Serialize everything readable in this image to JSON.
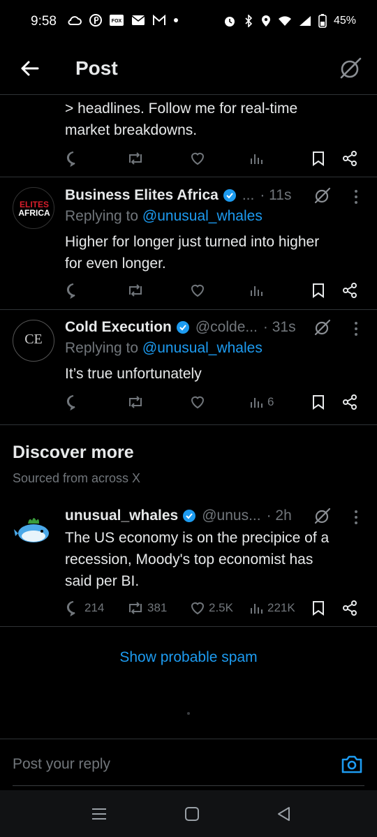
{
  "status_bar": {
    "time": "9:58",
    "battery": "45%",
    "left_icons": [
      "cloud-icon",
      "pinterest-icon",
      "fox-news-icon",
      "mail-icon",
      "gmail-icon",
      "dot-icon"
    ],
    "right_icons": [
      "alarm-icon",
      "bluetooth-icon",
      "location-icon",
      "wifi-icon",
      "signal-icon",
      "battery-icon"
    ]
  },
  "header": {
    "title": "Post"
  },
  "tweets": [
    {
      "text": "> headlines. Follow me for real-time market breakdowns.",
      "text_line1": "> headlines. Follow me for real-time",
      "text_line2": "market breakdowns."
    },
    {
      "name": "Business Elites Africa",
      "handle": "...",
      "time": "· 11s",
      "reply_prefix": "Replying to ",
      "reply_to": "@unusual_whales",
      "text_line1": "Higher for longer just turned into higher",
      "text_line2": "for even longer.",
      "avatar_text_1": "ELITES",
      "avatar_text_2": "AFRICA"
    },
    {
      "name": "Cold Execution",
      "handle": "@colde...",
      "time": "· 31s",
      "reply_prefix": "Replying to ",
      "reply_to": "@unusual_whales",
      "text_line1": "It’s true unfortunately",
      "views": "6",
      "avatar_text": "CE"
    }
  ],
  "discover": {
    "title": "Discover more",
    "subtitle": "Sourced from across X"
  },
  "discover_tweet": {
    "name": "unusual_whales",
    "handle": "@unus...",
    "time": "· 2h",
    "text_line1": "The US economy is on the precipice of a",
    "text_line2": "recession, Moody's top economist has",
    "text_line3": "said per BI.",
    "replies": "214",
    "reposts": "381",
    "likes": "2.5K",
    "views": "221K"
  },
  "spam_link": "Show probable spam",
  "reply_bar": {
    "placeholder": "Post your reply"
  },
  "colors": {
    "accent": "#1d9bf0",
    "muted": "#71767b",
    "background": "#000000",
    "text": "#e7e9ea"
  }
}
